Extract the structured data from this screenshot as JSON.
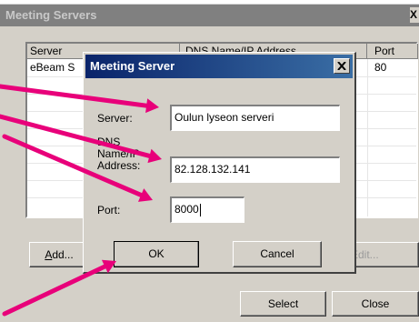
{
  "back_window": {
    "title": "Meeting Servers",
    "close_glyph": "X",
    "columns": [
      "Server",
      "DNS Name/IP Address",
      "Port"
    ],
    "rows": [
      {
        "server": "eBeam S",
        "address": "",
        "port": "80"
      }
    ],
    "buttons": {
      "add": {
        "pre": "",
        "u": "A",
        "post": "dd..."
      },
      "edit": "Edit...",
      "select": "Select",
      "close": "Close"
    }
  },
  "dialog": {
    "title": "Meeting Server",
    "close_icon": "close-x-icon",
    "fields": {
      "server": {
        "label": "Server:",
        "value": "Oulun lyseon serveri"
      },
      "address": {
        "label_lines": [
          "DNS",
          "Name/IP",
          "Address:"
        ],
        "value": "82.128.132.141"
      },
      "port": {
        "label": "Port:",
        "value": "8000"
      }
    },
    "buttons": {
      "ok": "OK",
      "cancel": "Cancel"
    }
  },
  "annotation": {
    "arrow_color": "#e8007a"
  }
}
